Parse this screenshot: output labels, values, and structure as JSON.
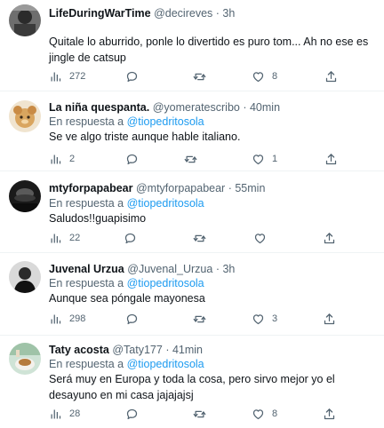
{
  "reply_prefix": "En respuesta a",
  "tweets": [
    {
      "name": "LifeDuringWarTime",
      "handle": "@decireves",
      "separator": "·",
      "time": "3h",
      "reply_to": "",
      "text": "Quitale lo aburrido, ponle lo divertido es puro tom... Ah no ese es jingle de catsup",
      "views": "272",
      "likes": "8"
    },
    {
      "name": "La niña quespanta.",
      "handle": "@yomeratescribo",
      "separator": "·",
      "time": "40min",
      "reply_to": "@tiopedritosola",
      "text": "Se ve algo triste aunque hable italiano.",
      "views": "2",
      "likes": "1"
    },
    {
      "name": "mtyforpapabear",
      "handle": "@mtyforpapabear",
      "separator": "·",
      "time": "55min",
      "reply_to": "@tiopedritosola",
      "text": "Saludos!!guapisimo",
      "views": "22",
      "likes": ""
    },
    {
      "name": "Juvenal Urzua",
      "handle": "@Juvenal_Urzua",
      "separator": "·",
      "time": "3h",
      "reply_to": "@tiopedritosola",
      "text": "Aunque sea póngale mayonesa",
      "views": "298",
      "likes": "3"
    },
    {
      "name": "Taty acosta",
      "handle": "@Taty177",
      "separator": "·",
      "time": "41min",
      "reply_to": "@tiopedritosola",
      "text": "Será muy en Europa y toda la cosa, pero sirvo mejor yo el desayuno en mi casa jajajajsj",
      "views": "28",
      "likes": "8"
    }
  ]
}
